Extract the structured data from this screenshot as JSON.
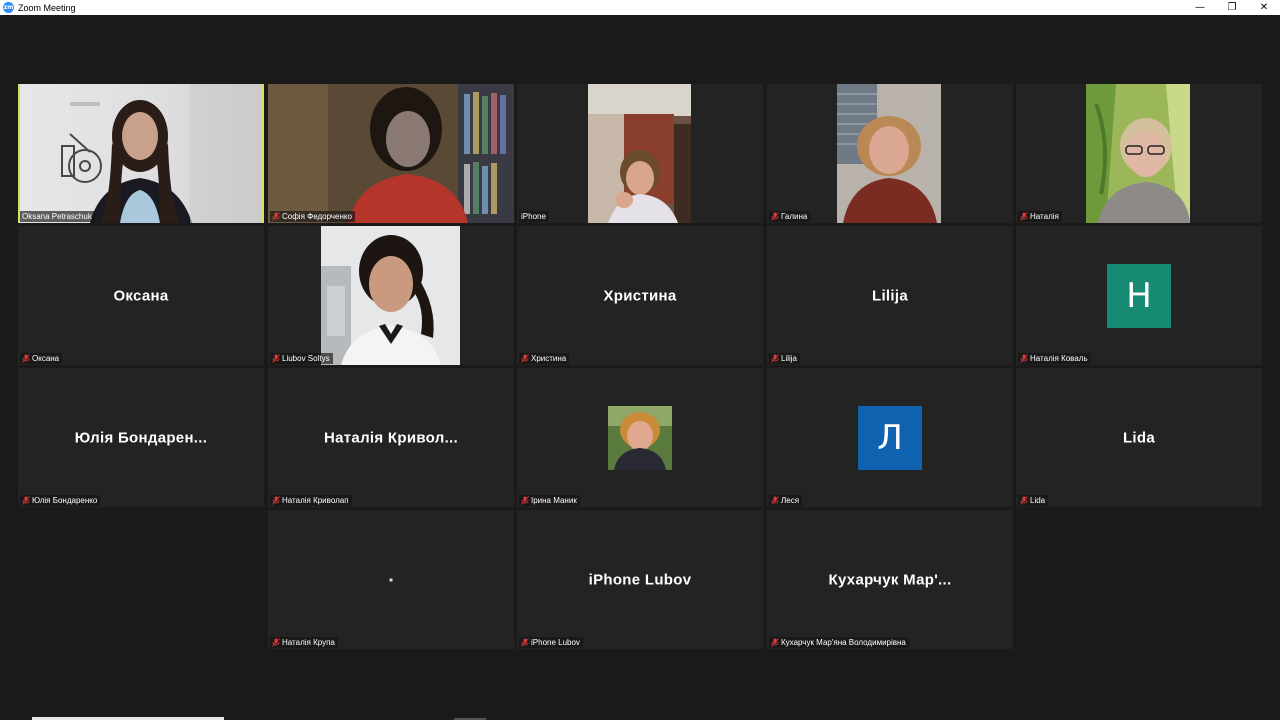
{
  "window": {
    "title": "Zoom Meeting",
    "app_icon": "zoom-icon",
    "controls": {
      "minimize": "—",
      "restore": "❐",
      "close": "✕"
    }
  },
  "colors": {
    "active_speaker_border": "#d4e35a",
    "tile_bg": "#232323",
    "avatar_teal": "#168a72",
    "avatar_blue": "#0e62b0",
    "muted_mic": "#e03a3a"
  },
  "participants": [
    {
      "label": "Oksana Petraschuk",
      "muted": false,
      "active": true,
      "kind": "video"
    },
    {
      "label": "Софія Федорченко",
      "muted": true,
      "kind": "video"
    },
    {
      "label": "iPhone",
      "muted": false,
      "kind": "video"
    },
    {
      "label": "Галина",
      "muted": true,
      "kind": "video"
    },
    {
      "label": "Наталія",
      "muted": true,
      "kind": "video"
    },
    {
      "label": "Оксана",
      "display": "Оксана",
      "muted": true,
      "kind": "name"
    },
    {
      "label": "Liubov Soltys",
      "muted": true,
      "kind": "video"
    },
    {
      "label": "Христина",
      "display": "Христина",
      "muted": true,
      "kind": "name"
    },
    {
      "label": "Lilija",
      "display": "Lilija",
      "muted": true,
      "kind": "name"
    },
    {
      "label": "Наталія Коваль",
      "avatar": "H",
      "muted": true,
      "kind": "avatar"
    },
    {
      "label": "Юлія Бондаренко",
      "display": "Юлія  Бондарен...",
      "muted": true,
      "kind": "name"
    },
    {
      "label": "Наталія Криволап",
      "display": "Наталія  Кривол...",
      "muted": true,
      "kind": "name"
    },
    {
      "label": "Ірина Маник",
      "muted": true,
      "kind": "photo"
    },
    {
      "label": "Леся",
      "avatar": "Л",
      "muted": true,
      "kind": "avatar"
    },
    {
      "label": "Lida",
      "display": "Lida",
      "muted": true,
      "kind": "name"
    },
    {
      "label": "Наталія Крупа",
      "muted": true,
      "kind": "blank"
    },
    {
      "label": "iPhone Lubov",
      "display": "iPhone Lubov",
      "muted": true,
      "kind": "name"
    },
    {
      "label": "Кухарчук Мар'яна Володимирівна",
      "display": "Кухарчук  Мар'...",
      "muted": true,
      "kind": "name"
    }
  ]
}
